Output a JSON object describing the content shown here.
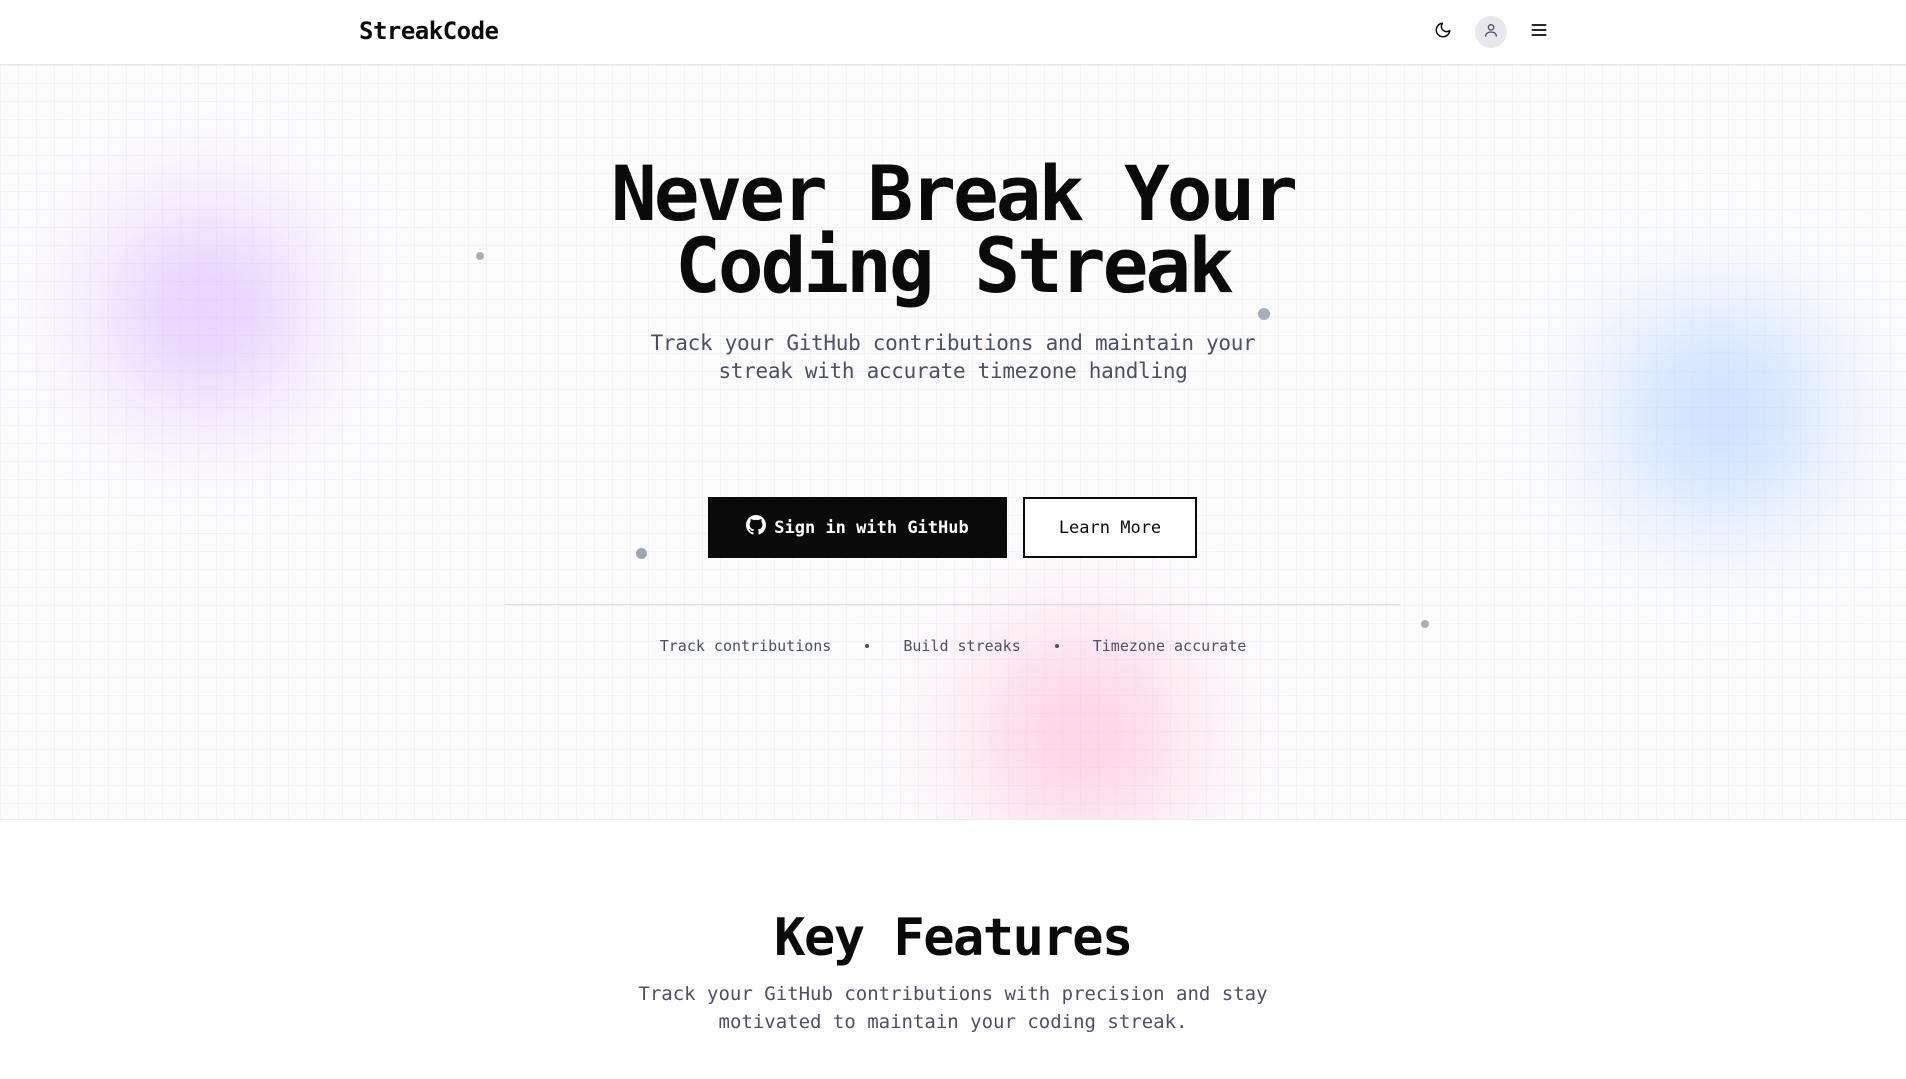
{
  "header": {
    "logo": "StreakCode",
    "icons": [
      "moon-icon",
      "user-icon",
      "menu-icon"
    ]
  },
  "hero": {
    "title_line1": "Never Break Your",
    "title_line2": "Coding Streak",
    "subtitle_line1": "Track your GitHub contributions and maintain your",
    "subtitle_line2": "streak with accurate timezone handling",
    "primary_button": "Sign in with GitHub",
    "secondary_button": "Learn More",
    "highlights": [
      "Track contributions",
      "Build streaks",
      "Timezone accurate"
    ]
  },
  "features": {
    "title": "Key Features",
    "subtitle_line1": "Track your GitHub contributions with precision and stay",
    "subtitle_line2": "motivated to maintain your coding streak."
  },
  "colors": {
    "primary": "#0a0a0a",
    "muted_text": "#4a5065",
    "blob_purple": "#d6aaff",
    "blob_blue": "#aacdff",
    "blob_pink": "#ffafd2"
  }
}
